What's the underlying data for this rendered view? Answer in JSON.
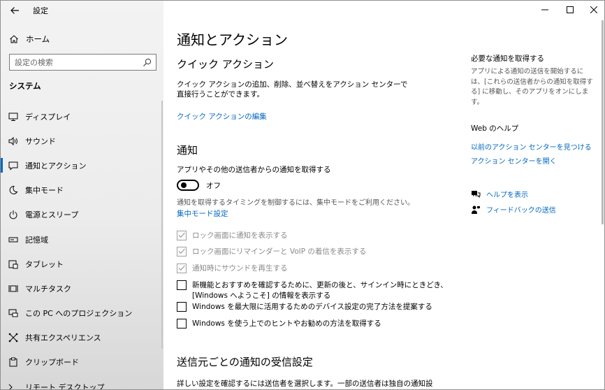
{
  "window": {
    "title": "設定",
    "icons": {
      "back": "back-arrow-icon",
      "minimize": "minimize-icon",
      "maximize": "maximize-icon",
      "close": "close-icon"
    }
  },
  "sidebar": {
    "home_label": "ホーム",
    "search_placeholder": "設定の検索",
    "section_title": "システム",
    "items": [
      {
        "label": "ディスプレイ",
        "icon": "display-icon"
      },
      {
        "label": "サウンド",
        "icon": "sound-icon"
      },
      {
        "label": "通知とアクション",
        "icon": "notification-icon",
        "selected": true
      },
      {
        "label": "集中モード",
        "icon": "moon-icon"
      },
      {
        "label": "電源とスリープ",
        "icon": "power-icon"
      },
      {
        "label": "記憶域",
        "icon": "storage-icon"
      },
      {
        "label": "タブレット",
        "icon": "tablet-icon"
      },
      {
        "label": "マルチタスク",
        "icon": "multitask-icon"
      },
      {
        "label": "この PC へのプロジェクション",
        "icon": "projection-icon"
      },
      {
        "label": "共有エクスペリエンス",
        "icon": "shared-icon"
      },
      {
        "label": "クリップボード",
        "icon": "clipboard-icon"
      },
      {
        "label": "リモート デスクトップ",
        "icon": "remote-desktop-icon"
      }
    ],
    "accent_color": "#0067c0"
  },
  "main": {
    "page_title": "通知とアクション",
    "quick_actions": {
      "heading": "クイック アクション",
      "description": "クイック アクションの追加、削除、並べ替えをアクション センターで直接行うことができます。",
      "edit_link": "クイック アクションの編集"
    },
    "notifications": {
      "heading": "通知",
      "toggle_label": "アプリやその他の送信者からの通知を取得する",
      "toggle_state": "オフ",
      "focus_text": "通知を取得するタイミングを制御するには、集中モードをご利用ください。",
      "focus_link": "集中モード設定",
      "checkboxes": [
        {
          "label": "ロック画面に通知を表示する",
          "checked": true,
          "disabled": true
        },
        {
          "label": "ロック画面にリマインダーと VoIP の着信を表示する",
          "checked": true,
          "disabled": true
        },
        {
          "label": "通知時にサウンドを再生する",
          "checked": true,
          "disabled": true
        },
        {
          "label": "新機能とおすすめを確認するために、更新の後と、サインイン時にときどき、",
          "label2": "[Windows へようこそ] の情報を表示する",
          "checked": false,
          "disabled": false
        },
        {
          "label": "Windows を最大限に活用するためのデバイス設定の完了方法を提案する",
          "checked": false,
          "disabled": false
        },
        {
          "label": "Windows を使う上でのヒントやお勧めの方法を取得する",
          "checked": false,
          "disabled": false
        }
      ]
    },
    "per_sender": {
      "heading": "送信元ごとの通知の受信設定",
      "description": "詳しい設定を確認するには送信者を選択します。一部の送信者は独自の通知設"
    }
  },
  "right": {
    "get_notifications_title": "必要な通知を取得する",
    "get_notifications_text": "アプリによる通知の送信を開始するには、[これらの送信者からの通知を取得する] に移動し、そのアプリをオンにします。",
    "web_help_title": "Web のヘルプ",
    "web_links": [
      "以前のアクション センターを見つける",
      "アクション センターを開く"
    ],
    "help_link": "ヘルプを表示",
    "feedback_link": "フィードバックの送信"
  }
}
